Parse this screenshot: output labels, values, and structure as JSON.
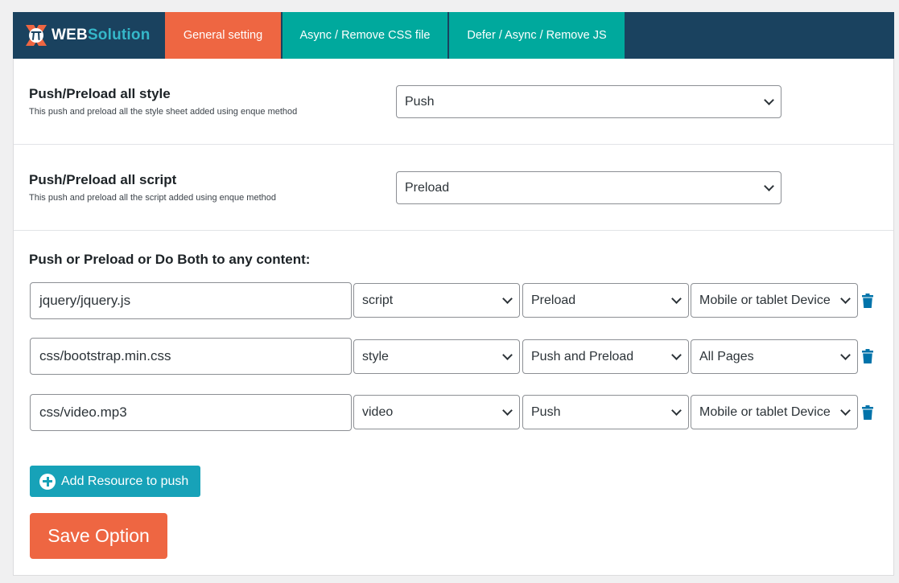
{
  "brand": {
    "part1": "WEB",
    "part2": "Solution",
    "logo_icon": "pi-x-logo-icon",
    "colors": {
      "navy": "#1a425f",
      "orange": "#ee6642",
      "teal": "#00a99d",
      "cyan": "#35b7c9"
    }
  },
  "tabs": [
    {
      "label": "General setting",
      "active": true
    },
    {
      "label": "Async / Remove CSS file",
      "active": false
    },
    {
      "label": "Defer / Async / Remove JS",
      "active": false
    }
  ],
  "settings": {
    "style": {
      "title": "Push/Preload all style",
      "description": "This push and preload all the style sheet added using enque method",
      "value": "Push"
    },
    "script": {
      "title": "Push/Preload all script",
      "description": "This push and preload all the script added using enque method",
      "value": "Preload"
    }
  },
  "resources": {
    "title": "Push or Preload or Do Both to any content:",
    "rows": [
      {
        "url": "jquery/jquery.js",
        "type": "script",
        "mode": "Preload",
        "device": "Mobile or tablet Device"
      },
      {
        "url": "css/bootstrap.min.css",
        "type": "style",
        "mode": "Push and Preload",
        "device": "All Pages"
      },
      {
        "url": "css/video.mp3",
        "type": "video",
        "mode": "Push",
        "device": "Mobile or tablet Device"
      }
    ],
    "delete_icon": "trash-icon",
    "add_label": "Add Resource to push",
    "add_icon": "plus-circle-icon"
  },
  "save_label": "Save Option",
  "icon_chevron": "chevron-down-icon"
}
